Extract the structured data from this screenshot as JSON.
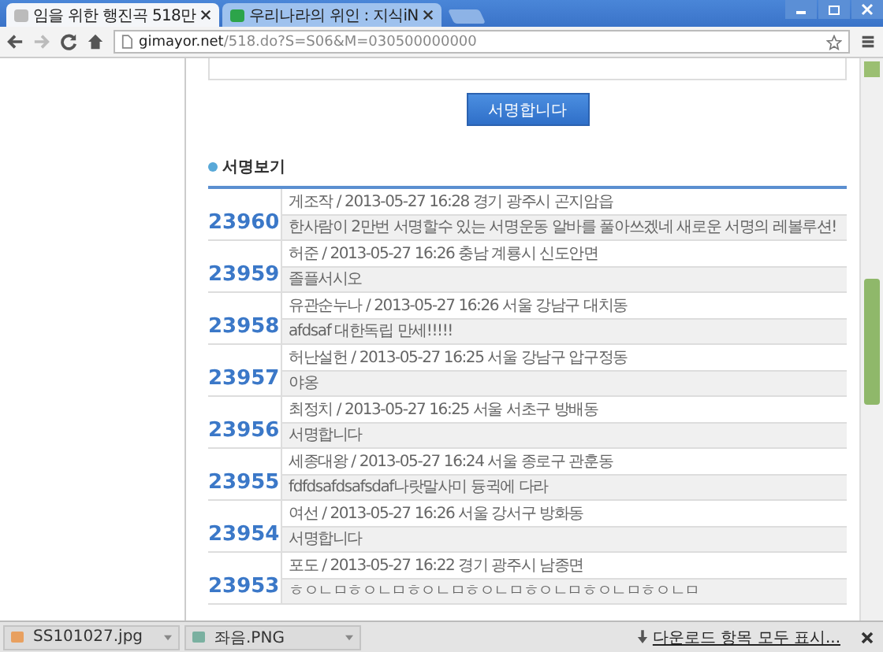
{
  "tabs": [
    {
      "title": "임을 위한 행진곡 518만",
      "selected": true
    },
    {
      "title": "우리나라의 위인 : 지식iN",
      "selected": false
    }
  ],
  "address": {
    "host": "gimayor.net",
    "path": "/518.do?S=S06&M=030500000000"
  },
  "sign_button": "서명합니다",
  "section_title": "서명보기",
  "signatures": [
    {
      "number": "23960",
      "meta": "게조작 / 2013-05-27 16:28 경기 광주시 곤지암읍",
      "message": "한사람이 2만번 서명할수 있는 서명운동 알바를 풀아쓰겠네 새로운 서명의 레볼루션!"
    },
    {
      "number": "23959",
      "meta": "허준 / 2013-05-27 16:26 충남 계룡시 신도안면",
      "message": "졸플서시오"
    },
    {
      "number": "23958",
      "meta": "유관순누나 / 2013-05-27 16:26 서울 강남구 대치동",
      "message": "afdsaf 대한독립 만세!!!!!"
    },
    {
      "number": "23957",
      "meta": "허난설헌 / 2013-05-27 16:25 서울 강남구 압구정동",
      "message": "야옹"
    },
    {
      "number": "23956",
      "meta": "최정치 / 2013-05-27 16:25 서울 서초구 방배동",
      "message": "서명합니다"
    },
    {
      "number": "23955",
      "meta": "세종대왕 / 2013-05-27 16:24 서울 종로구 관훈동",
      "message": "fdfdsafdsafsdaf나랏말사미 듕귁에 다라"
    },
    {
      "number": "23954",
      "meta": "여선 / 2013-05-27 16:26 서울 강서구 방화동",
      "message": "서명합니다"
    },
    {
      "number": "23953",
      "meta": "포도 / 2013-05-27 16:22 경기 광주시 남종면",
      "message": "ㅎㅇㄴㅁㅎㅇㄴㅁㅎㅇㄴㅁㅎㅇㄴㅁㅎㅇㄴㅁㅎㅇㄴㅁㅎㅇㄴㅁ"
    }
  ],
  "downloads": [
    {
      "file": "SS101027.jpg"
    },
    {
      "file": "좌음.PNG"
    }
  ],
  "show_all_downloads": "다운로드 항목 모두 표시..."
}
